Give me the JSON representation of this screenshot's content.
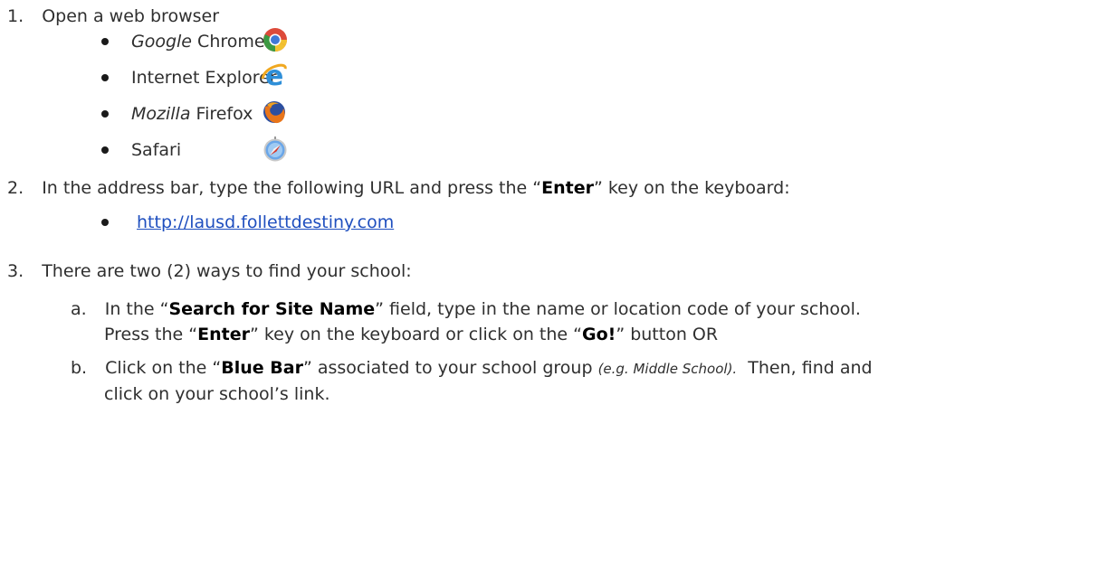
{
  "steps": {
    "s1": {
      "num": "1.",
      "text": "Open a web browser"
    },
    "browsers": [
      {
        "italic": "Google",
        "name": " Chrome",
        "icon": "chrome-icon"
      },
      {
        "italic": "",
        "name": "Internet Explorer",
        "icon": "internet-explorer-icon"
      },
      {
        "italic": "Mozilla",
        "name": " Firefox",
        "icon": "firefox-icon"
      },
      {
        "italic": "",
        "name": "Safari",
        "icon": "safari-icon"
      }
    ],
    "s2": {
      "num": "2.",
      "pre": "In the address bar, type the following URL and press the “",
      "key": "Enter",
      "post": "” key on the keyboard:"
    },
    "url": "http://lausd.follettdestiny.com",
    "s3": {
      "num": "3.",
      "text": "There are two (2) ways to find your school:"
    },
    "a": {
      "letter": "a.",
      "pre": "In the “",
      "field": "Search for Site Name",
      "post": "” field, type in the name or location code of your school.",
      "l2_pre": "Press the “",
      "key": "Enter",
      "l2_mid": "” key on the keyboard or click on the “",
      "go": "Go!",
      "l2_post": "” button OR"
    },
    "b": {
      "letter": "b.",
      "pre": "Click on the “",
      "bar": "Blue Bar",
      "mid": "” associated to your school group ",
      "eg": "(e.g. Middle School).",
      "post": "  Then, find and",
      "l2": "click on your school’s link."
    }
  }
}
